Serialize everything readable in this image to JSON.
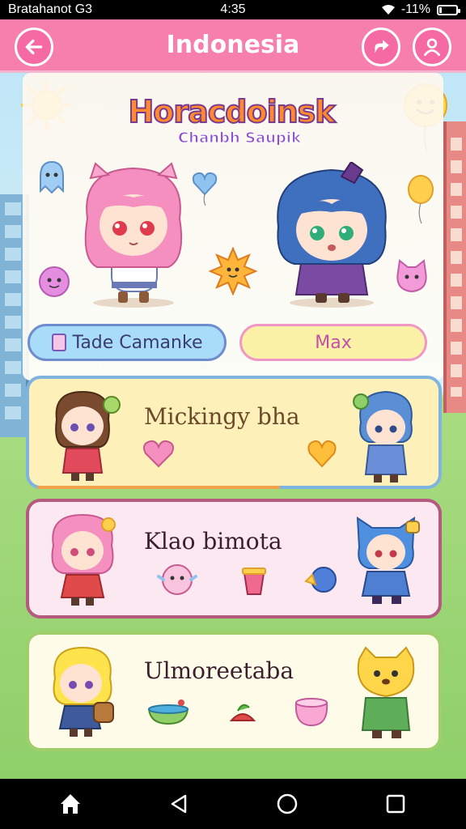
{
  "status_bar": {
    "carrier": "Bratahanot G3",
    "time": "4:35",
    "battery": "-11%",
    "battery_level_percent": 11,
    "icons": [
      "wifi-icon",
      "battery-icon"
    ]
  },
  "header": {
    "title": "Indonesia",
    "icons": [
      "back-arrow-icon",
      "share-icon",
      "profile-icon"
    ]
  },
  "banner": {
    "title": "Horacdoinsk",
    "subtitle": "Chanbh Saupik"
  },
  "selector": {
    "left_label": "Tade Camanke",
    "right_label": "Max"
  },
  "cards": [
    {
      "name": "Mickingy bha"
    },
    {
      "name": "Klao bimota"
    },
    {
      "name": "Ulmoreetaba"
    }
  ],
  "nav": {
    "icons": [
      "home-icon",
      "back-triangle-icon",
      "home-circle-icon",
      "recents-square-icon"
    ]
  },
  "colors": {
    "header": "#f77fae",
    "accent_blue": "#7fb4e0",
    "accent_pink": "#b45a7f",
    "accent_green": "#9fce6a"
  }
}
